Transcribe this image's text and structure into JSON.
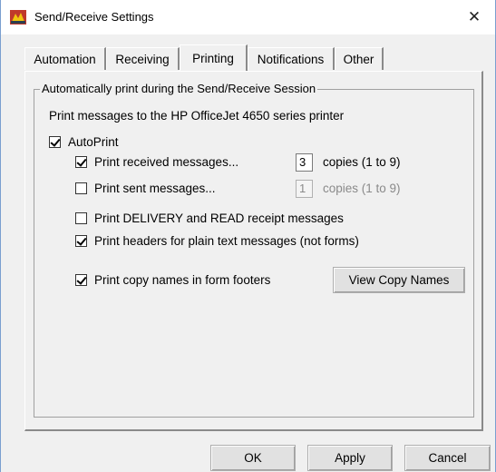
{
  "window": {
    "title": "Send/Receive Settings",
    "close_icon": "close-icon"
  },
  "tabs": [
    {
      "label": "Automation",
      "active": false
    },
    {
      "label": "Receiving",
      "active": false
    },
    {
      "label": "Printing",
      "active": true
    },
    {
      "label": "Notifications",
      "active": false
    },
    {
      "label": "Other",
      "active": false
    }
  ],
  "group": {
    "legend": "Automatically print during the Send/Receive Session",
    "intro": "Print messages to the HP OfficeJet 4650 series printer"
  },
  "options": {
    "autoprint": {
      "label": "AutoPrint",
      "checked": true
    },
    "received": {
      "label": "Print received messages...",
      "checked": true,
      "copies": "3",
      "copies_label": "copies (1 to 9)"
    },
    "sent": {
      "label": "Print sent messages...",
      "checked": false,
      "copies": "1",
      "copies_label": "copies (1 to 9)"
    },
    "receipts": {
      "label": "Print DELIVERY and READ receipt messages",
      "checked": false
    },
    "headers": {
      "label": "Print headers for plain text messages (not forms)",
      "checked": true
    },
    "copy_names": {
      "label": "Print copy names in form footers",
      "checked": true
    }
  },
  "buttons": {
    "view_copy_names": "View Copy Names",
    "ok": "OK",
    "apply": "Apply",
    "cancel": "Cancel"
  }
}
